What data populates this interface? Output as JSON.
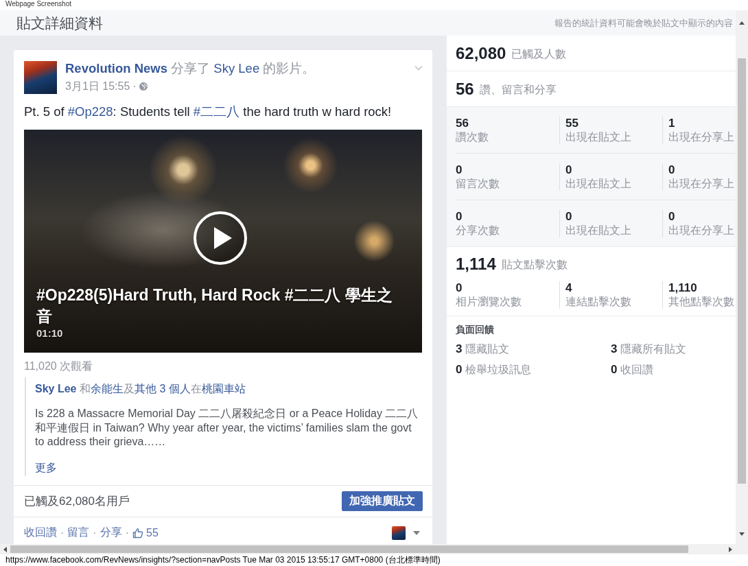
{
  "caption": "Webpage Screenshot",
  "page_header": {
    "title": "貼文詳細資料",
    "note": "報告的統計資料可能會晚於貼文中顯示的內容"
  },
  "post": {
    "author": "Revolution News",
    "action": "分享了",
    "shared_from": "Sky Lee",
    "action_suffix": "的影片。",
    "timestamp": "3月1日 15:55",
    "separator": "·",
    "message": [
      {
        "kind": "text",
        "text": "Pt. 5 of "
      },
      {
        "kind": "hashtag",
        "text": "#Op228"
      },
      {
        "kind": "text",
        "text": ": Students tell "
      },
      {
        "kind": "hashtag",
        "text": "#二二八"
      },
      {
        "kind": "text",
        "text": " the hard truth w hard rock!"
      }
    ],
    "video": {
      "title": "#Op228(5)Hard Truth, Hard Rock #二二八 學生之音",
      "duration": "01:10"
    },
    "views": "11,020 次觀看",
    "attachment": {
      "tag_line": [
        {
          "kind": "name",
          "text": "Sky Lee"
        },
        {
          "kind": "text",
          "text": " 和"
        },
        {
          "kind": "link",
          "text": "余能生"
        },
        {
          "kind": "text",
          "text": "及"
        },
        {
          "kind": "link",
          "text": "其他 3 個人"
        },
        {
          "kind": "text",
          "text": "在"
        },
        {
          "kind": "link",
          "text": "桃園車站"
        }
      ],
      "description": "Is 228 a Massacre Memorial Day 二二八屠殺紀念日 or a Peace Holiday 二二八和平連假日 in Taiwan? Why year after year, the victims’ families slam the govt to address their grieva……",
      "more": "更多"
    },
    "reach": "已觸及62,080名用戶",
    "boost_button": "加強推廣貼文",
    "actions": [
      "收回讚",
      "留言",
      "分享"
    ],
    "like_count": "55"
  },
  "insights": {
    "reach": {
      "value": "62,080",
      "label": "已觸及人數"
    },
    "engagement": {
      "value": "56",
      "label": "讚、留言和分享"
    },
    "engagement_rows": [
      {
        "cells": [
          {
            "value": "56",
            "label": "讚次數"
          },
          {
            "value": "55",
            "label": "出現在貼文上"
          },
          {
            "value": "1",
            "label": "出現在分享上"
          }
        ]
      },
      {
        "cells": [
          {
            "value": "0",
            "label": "留言次數"
          },
          {
            "value": "0",
            "label": "出現在貼文上"
          },
          {
            "value": "0",
            "label": "出現在分享上"
          }
        ]
      },
      {
        "cells": [
          {
            "value": "0",
            "label": "分享次數"
          },
          {
            "value": "0",
            "label": "出現在貼文上"
          },
          {
            "value": "0",
            "label": "出現在分享上"
          }
        ]
      }
    ],
    "clicks": {
      "value": "1,114",
      "label": "貼文點擊次數",
      "cells": [
        {
          "value": "0",
          "label": "相片瀏覽次數"
        },
        {
          "value": "4",
          "label": "連結點擊次數"
        },
        {
          "value": "1,110",
          "label": "其他點擊次數"
        }
      ]
    },
    "negative_feedback": {
      "title": "負面回饋",
      "items": [
        {
          "value": "3",
          "label": "隱藏貼文"
        },
        {
          "value": "3",
          "label": "隱藏所有貼文"
        },
        {
          "value": "0",
          "label": "檢舉垃圾訊息"
        },
        {
          "value": "0",
          "label": "收回讚"
        }
      ]
    }
  },
  "status_bar": "https://www.facebook.com/RevNews/insights/?section=navPosts Tue Mar 03 2015 13:55:17 GMT+0800 (台北標準時間)"
}
